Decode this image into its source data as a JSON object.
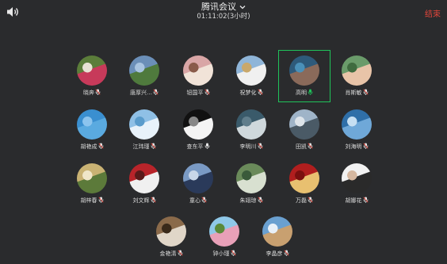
{
  "window": {
    "title": "腾讯会议",
    "duration": "01:11:02(3小时)",
    "end_label": "结束",
    "speaker_icon": "speaker-icon",
    "title_icon": "chevron-down-icon",
    "accent_end": "#e2463b",
    "accent_active": "#1fc35a"
  },
  "participants": [
    {
      "name": "晓奔",
      "mic": "muted",
      "avatar_colors": [
        "#5b7d3a",
        "#c73a5a",
        "#e8e2d4"
      ]
    },
    {
      "name": "唐厚兴…",
      "mic": "muted",
      "avatar_colors": [
        "#6b8fb8",
        "#4f7a3d",
        "#a8c4e0"
      ]
    },
    {
      "name": "钮国平",
      "mic": "muted",
      "avatar_colors": [
        "#d9a6a6",
        "#f1e3d8",
        "#8a5b4a"
      ]
    },
    {
      "name": "祝梦化",
      "mic": "muted",
      "avatar_colors": [
        "#8fb5d8",
        "#f0f0f0",
        "#c9a86b"
      ]
    },
    {
      "name": "高明",
      "mic": "speaking",
      "avatar_colors": [
        "#2e5a7a",
        "#8a6a5a",
        "#4a90b8"
      ]
    },
    {
      "name": "肖斯敏",
      "mic": "muted",
      "avatar_colors": [
        "#6a9b6a",
        "#e8c4a8",
        "#3f6b3f"
      ]
    },
    {
      "name": "胡艳成",
      "mic": "muted",
      "avatar_colors": [
        "#3a8fd0",
        "#5aaae0",
        "#8cc4ee"
      ]
    },
    {
      "name": "江玮瑾",
      "mic": "muted",
      "avatar_colors": [
        "#8fc0e6",
        "#e8f2fa",
        "#5a9ccc"
      ]
    },
    {
      "name": "查东平",
      "mic": "on",
      "avatar_colors": [
        "#111111",
        "#f4f4f4",
        "#888888"
      ]
    },
    {
      "name": "李明川",
      "mic": "muted",
      "avatar_colors": [
        "#3a5a6a",
        "#cfd8dc",
        "#607d8b"
      ]
    },
    {
      "name": "田凯",
      "mic": "muted",
      "avatar_colors": [
        "#9fb4c8",
        "#4a5a66",
        "#dde4ea"
      ]
    },
    {
      "name": "刘海明",
      "mic": "muted",
      "avatar_colors": [
        "#2f6fa8",
        "#6fa8d8",
        "#c6dff2"
      ]
    },
    {
      "name": "胡梓春",
      "mic": "muted",
      "avatar_colors": [
        "#c9b273",
        "#5c7a3a",
        "#f0e6c8"
      ]
    },
    {
      "name": "刘文辉",
      "mic": "muted",
      "avatar_colors": [
        "#b8242a",
        "#f0f0f0",
        "#5a1a1a"
      ]
    },
    {
      "name": "童心",
      "mic": "muted",
      "avatar_colors": [
        "#7a9ac4",
        "#2a3a5a",
        "#c8d6e8"
      ]
    },
    {
      "name": "朱翊琼",
      "mic": "muted",
      "avatar_colors": [
        "#6a8a5a",
        "#d8e0d0",
        "#3a5a3a"
      ]
    },
    {
      "name": "万磊",
      "mic": "muted",
      "avatar_colors": [
        "#b01e1e",
        "#e8c070",
        "#7a0f0f"
      ]
    },
    {
      "name": "胡娜花",
      "mic": "muted",
      "avatar_colors": [
        "#f2f2f2",
        "#2a2a2a",
        "#d6b8a0"
      ]
    },
    {
      "name": "金艳清",
      "mic": "muted",
      "avatar_colors": [
        "#8a6a4a",
        "#e0d6c8",
        "#3a2a1a"
      ]
    },
    {
      "name": "钟小瑾",
      "mic": "muted",
      "avatar_colors": [
        "#8fc8e8",
        "#e8a0b8",
        "#5a8a3a"
      ]
    },
    {
      "name": "李晶彦",
      "mic": "muted",
      "avatar_colors": [
        "#6aa0d0",
        "#c8a070",
        "#e8f0f8"
      ]
    }
  ]
}
